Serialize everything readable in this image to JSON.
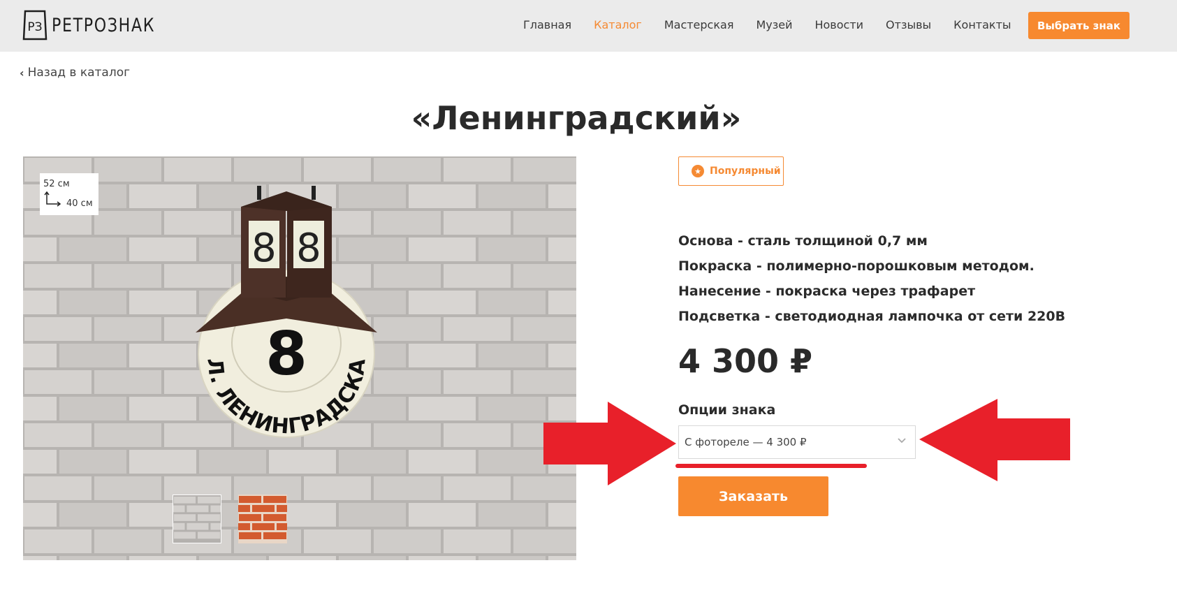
{
  "header": {
    "logo_text": "РЕТРОЗНАК",
    "logo_mark": "РЗ",
    "nav": [
      "Главная",
      "Каталог",
      "Мастерская",
      "Музей",
      "Новости",
      "Отзывы",
      "Контакты"
    ],
    "active_nav": "Каталог",
    "cta_label": "Выбрать знак",
    "accent_color": "#f7892f"
  },
  "breadcrumb": {
    "back_label": "Назад в каталог"
  },
  "product": {
    "title": "«Ленинградский»",
    "dimensions": {
      "height": "52 см",
      "width": "40 см"
    },
    "sign": {
      "number": "8",
      "street": "УЛ. ЛЕНИНГРАДСКАЯ"
    },
    "badge": "Популярный",
    "specs": [
      "Основа - сталь толщиной 0,7 мм",
      "Покраска - полимерно-порошковым методом.",
      "Нанесение - покраска через трафарет",
      "Подсветка - светодиодная лампочка от сети 220В"
    ],
    "price": "4 300 ₽",
    "options_label": "Опции знака",
    "selected_option": "С фотореле  — 4 300  ₽",
    "order_label": "Заказать"
  },
  "annotation_color": "#e8202a"
}
